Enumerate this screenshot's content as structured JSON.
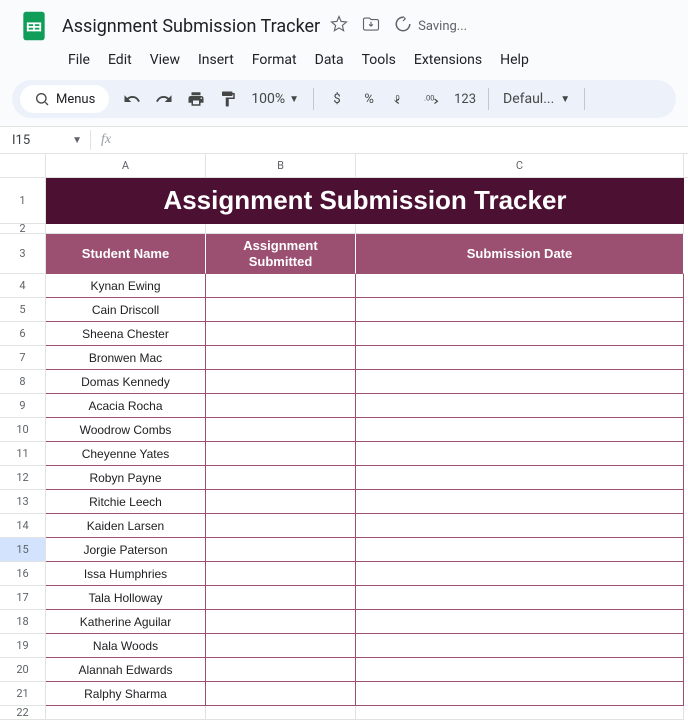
{
  "doc": {
    "title": "Assignment Submission Tracker",
    "saving_label": "Saving..."
  },
  "menubar": {
    "file": "File",
    "edit": "Edit",
    "view": "View",
    "insert": "Insert",
    "format": "Format",
    "data": "Data",
    "tools": "Tools",
    "extensions": "Extensions",
    "help": "Help"
  },
  "toolbar": {
    "menus_label": "Menus",
    "zoom": "100%",
    "currency": "$",
    "percent": "%",
    "num_format": "123",
    "font": "Defaul..."
  },
  "namebox": {
    "value": "I15"
  },
  "columns": {
    "A": "A",
    "B": "B",
    "C": "C"
  },
  "sheet": {
    "banner_title": "Assignment Submission Tracker",
    "headers": {
      "student_name": "Student Name",
      "assignment_submitted": "Assignment Submitted",
      "submission_date": "Submission Date"
    },
    "selected_row_num": "15",
    "rows": [
      "Kynan Ewing",
      "Cain Driscoll",
      "Sheena Chester",
      "Bronwen Mac",
      "Domas Kennedy",
      "Acacia Rocha",
      "Woodrow Combs",
      "Cheyenne Yates",
      "Robyn Payne",
      "Ritchie Leech",
      "Kaiden Larsen",
      "Jorgie Paterson",
      "Issa Humphries",
      "Tala Holloway",
      "Katherine Aguilar",
      "Nala Woods",
      "Alannah Edwards",
      "Ralphy Sharma"
    ],
    "row_numbers": [
      "1",
      "2",
      "3",
      "4",
      "5",
      "6",
      "7",
      "8",
      "9",
      "10",
      "11",
      "12",
      "13",
      "14",
      "15",
      "16",
      "17",
      "18",
      "19",
      "20",
      "21",
      "22"
    ]
  }
}
